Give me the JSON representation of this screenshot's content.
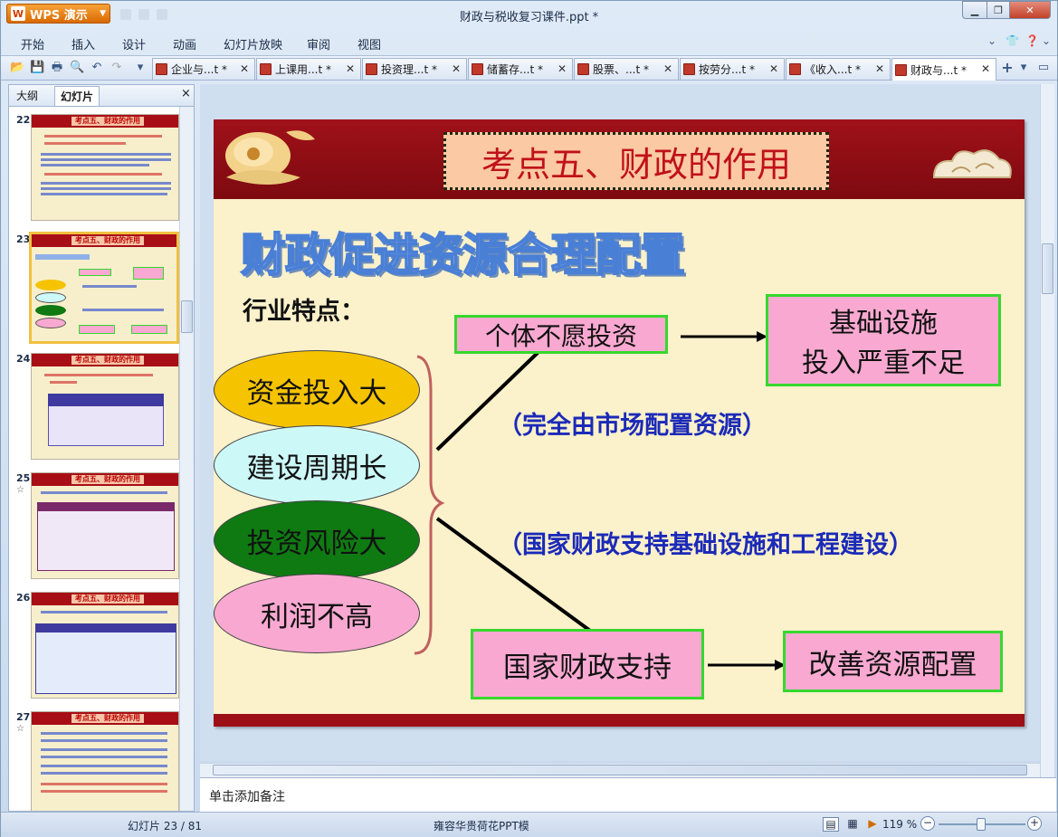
{
  "app": {
    "name": "WPS 演示",
    "window_title": "财政与税收复习课件.ppt *"
  },
  "menu": [
    "开始",
    "插入",
    "设计",
    "动画",
    "幻灯片放映",
    "审阅",
    "视图"
  ],
  "tabs": [
    {
      "label": "企业与...t *"
    },
    {
      "label": "上课用...t *"
    },
    {
      "label": "投资理...t *"
    },
    {
      "label": "储蓄存...t *"
    },
    {
      "label": "股票、...t *"
    },
    {
      "label": "按劳分...t *"
    },
    {
      "label": "《收入...t *"
    },
    {
      "label": "财政与...t *"
    }
  ],
  "left_panel": {
    "tab_outline": "大纲",
    "tab_slides": "幻灯片",
    "close": "×"
  },
  "thumbnails": [
    {
      "num": "22",
      "title": "考点五、财政的作用"
    },
    {
      "num": "23",
      "title": "考点五、财政的作用"
    },
    {
      "num": "24",
      "title": "考点五、财政的作用"
    },
    {
      "num": "25",
      "title": "考点五、财政的作用",
      "star": "☆"
    },
    {
      "num": "26",
      "title": "考点五、财政的作用"
    },
    {
      "num": "27",
      "title": "考点五、财政的作用",
      "star": "☆"
    }
  ],
  "slide": {
    "title": "考点五、财政的作用",
    "heading": "财政促进资源合理配置",
    "subheading": "行业特点：",
    "features": [
      "资金投入大",
      "建设周期长",
      "投资风险大",
      "利润不高"
    ],
    "box_private": "个体不愿投资",
    "box_infra_line1": "基础设施",
    "box_infra_line2": "投入严重不足",
    "note_market": "（完全由市场配置资源）",
    "note_state": "（国家财政支持基础设施和工程建设）",
    "box_support": "国家财政支持",
    "box_improve": "改善资源配置"
  },
  "colors": {
    "ellipse1": "#f5c300",
    "ellipse2": "#cdf8f8",
    "ellipse3": "#0f7a12",
    "ellipse4": "#f9a9d1",
    "band": "#a01119"
  },
  "notes_placeholder": "单击添加备注",
  "status": {
    "slide_pos": "幻灯片 23 / 81",
    "template": "雍容华贵荷花PPT模",
    "zoom": "119 %"
  }
}
